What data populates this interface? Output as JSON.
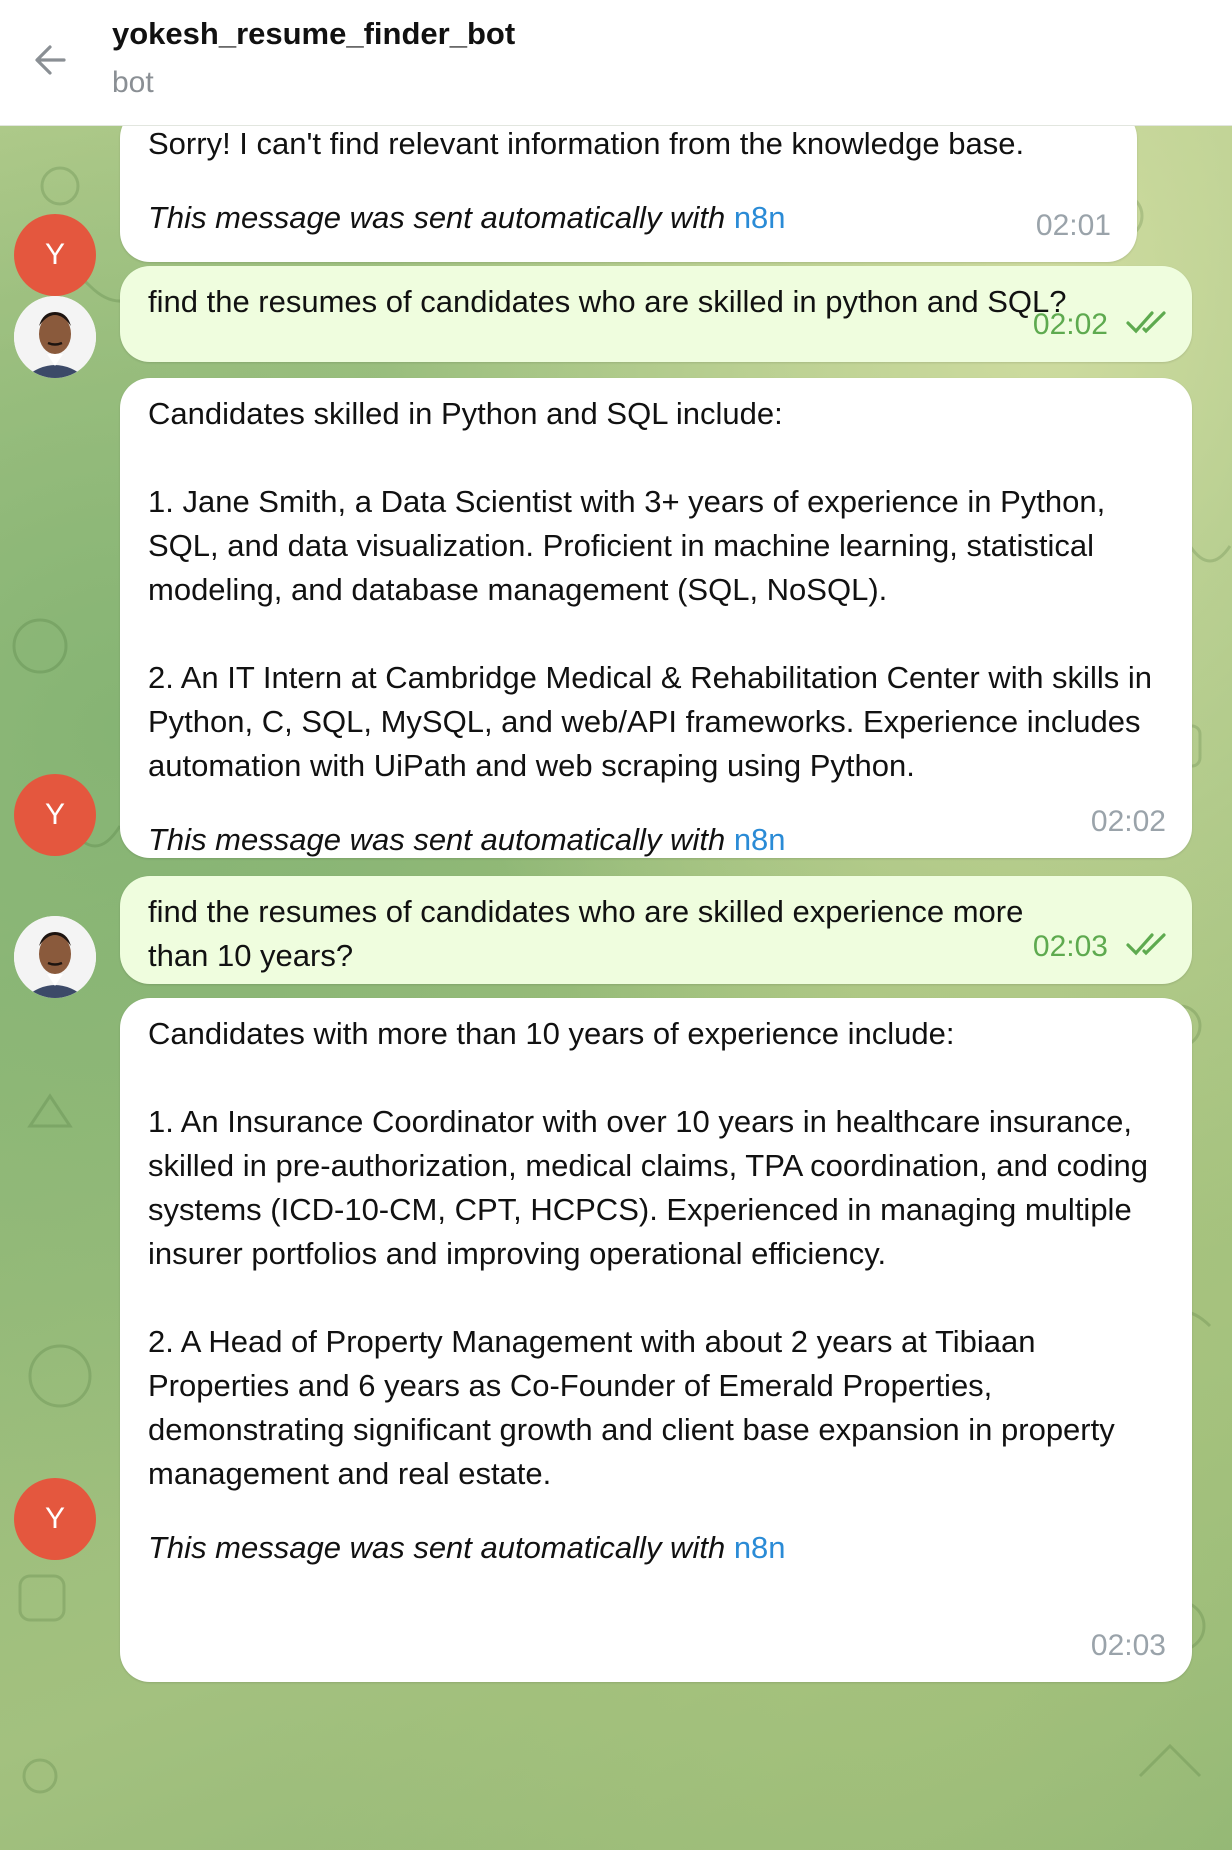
{
  "header": {
    "title": "yokesh_resume_finder_bot",
    "subtitle": "bot"
  },
  "bot_avatar_initial": "Y",
  "auto_note": "This message was sent automatically with",
  "auto_link": "n8n",
  "messages": [
    {
      "sender": "bot",
      "text": "Sorry! I can't find relevant information from the knowledge base.",
      "time": "02:01"
    },
    {
      "sender": "user",
      "text": "find the resumes of candidates who are skilled in python and SQL?",
      "time": "02:02",
      "status": "read"
    },
    {
      "sender": "bot",
      "text": "Candidates skilled in Python and SQL include:\n\n1. Jane Smith, a Data Scientist with 3+ years of experience in Python, SQL, and data visualization. Proficient in machine learning, statistical modeling, and database management (SQL, NoSQL).\n\n2. An IT Intern at Cambridge Medical & Rehabilitation Center with skills in Python, C, SQL, MySQL, and web/API frameworks. Experience includes automation with UiPath and web scraping using Python.",
      "time": "02:02"
    },
    {
      "sender": "user",
      "text": "find the resumes of candidates who are skilled experience more than 10 years?",
      "time": "02:03",
      "status": "read"
    },
    {
      "sender": "bot",
      "text": "Candidates with more than 10 years of experience include:\n\n1. An Insurance Coordinator with over 10 years in healthcare insurance, skilled in pre-authorization, medical claims, TPA coordination, and coding systems (ICD-10-CM, CPT, HCPCS). Experienced in managing multiple insurer portfolios and improving operational efficiency.\n\n2. A Head of Property Management with about 2 years at Tibiaan Properties and 6 years as Co-Founder of Emerald Properties, demonstrating significant growth and client base expansion in property management and real estate.",
      "time": "02:03"
    }
  ],
  "colors": {
    "incoming_bubble": "#ffffff",
    "outgoing_bubble": "#effdde",
    "link": "#2a8bd6",
    "read_check": "#5eaa4f",
    "bot_avatar": "#e4573e"
  },
  "icons": [
    "back-arrow-icon",
    "double-check-icon",
    "user-photo-avatar"
  ]
}
